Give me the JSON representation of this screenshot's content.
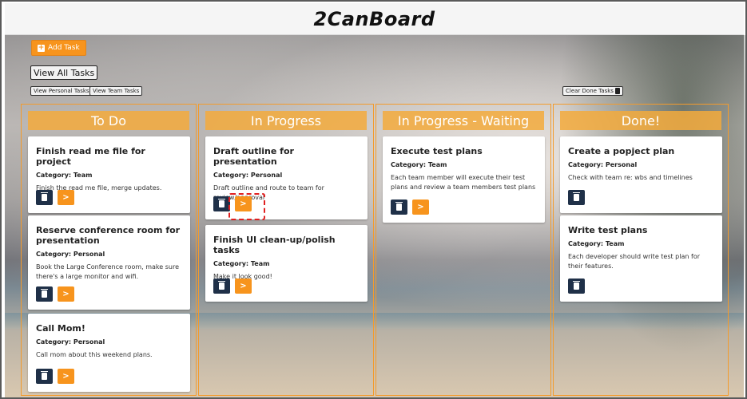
{
  "app": {
    "logo": "2CanBoard"
  },
  "toolbar": {
    "add_task": "Add Task",
    "view_all": "View All Tasks",
    "view_personal": "View Personal Tasks",
    "view_team": "View Team Tasks",
    "clear_done": "Clear Done Tasks"
  },
  "columns": [
    {
      "title": "To Do",
      "cards": [
        {
          "title": "Finish read me file for project",
          "category": "Category: Team",
          "desc": "Finish the read me file, merge updates."
        },
        {
          "title": "Reserve conference room for presentation",
          "category": "Category: Personal",
          "desc": "Book the Large Conference room, make sure there's a large monitor and wifi."
        },
        {
          "title": "Call Mom!",
          "category": "Category: Personal",
          "desc": "Call mom about this weekend plans."
        }
      ]
    },
    {
      "title": "In Progress",
      "cards": [
        {
          "title": "Draft outline for presentation",
          "category": "Category: Personal",
          "desc": "Draft outline and route to team for review/approval"
        },
        {
          "title": "Finish UI clean-up/polish tasks",
          "category": "Category: Team",
          "desc": "Make it look good!"
        }
      ]
    },
    {
      "title": "In Progress - Waiting",
      "cards": [
        {
          "title": "Execute test plans",
          "category": "Category: Team",
          "desc": "Each team member will execute their test plans and review a team members test plans"
        }
      ]
    },
    {
      "title": "Done!",
      "cards": [
        {
          "title": "Create a popject plan",
          "category": "Category: Personal",
          "desc": "Check with team re: wbs and timelines"
        },
        {
          "title": "Write test plans",
          "category": "Category: Team",
          "desc": "Each developer should write test plan for their features."
        }
      ]
    }
  ],
  "icons": {
    "next": ">"
  },
  "colors": {
    "accent": "#f7941d",
    "delete": "#1f3048",
    "column_border": "#f39b2c",
    "highlight": "#e02020"
  }
}
